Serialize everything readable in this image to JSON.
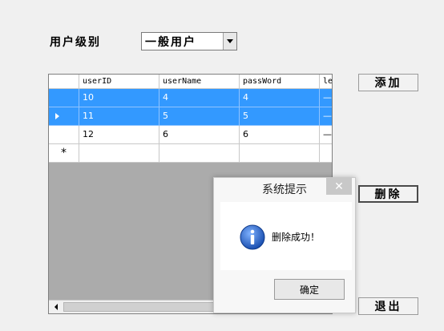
{
  "form": {
    "level_label": "用户级别",
    "level_value": "一般用户"
  },
  "buttons": {
    "add": "添加",
    "delete": "删除",
    "exit": "退出"
  },
  "grid": {
    "columns": [
      "userID",
      "userName",
      "passWord",
      "le"
    ],
    "rows": [
      {
        "cells": [
          "10",
          "4",
          "4",
          "—"
        ],
        "selected": true
      },
      {
        "cells": [
          "11",
          "5",
          "5",
          "—"
        ],
        "selected": true,
        "current": true
      },
      {
        "cells": [
          "12",
          "6",
          "6",
          "—"
        ],
        "selected": false
      }
    ],
    "new_row_marker": "*"
  },
  "dialog": {
    "title": "系统提示",
    "message": "删除成功！",
    "ok": "确定",
    "close_glyph": "✕"
  },
  "colors": {
    "selection": "#3399ff",
    "icon_blue": "#1f5fbf"
  }
}
